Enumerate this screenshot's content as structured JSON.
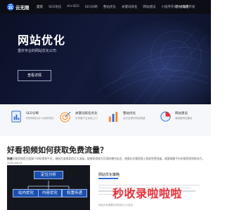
{
  "nav": {
    "logo_text": "云无限",
    "items": [
      "首页",
      "SEO优化",
      "AI+SEO",
      "SEO诊断",
      "整站优化",
      "关键词排名",
      "网站建设",
      "小程序开发",
      "APP开发"
    ],
    "phone": "热线电话"
  },
  "hero": {
    "title": "网站优化",
    "subtitle": "重庆专业的网站优化公司",
    "button": "查看详情",
    "slides_total": 3,
    "active_slide": 1
  },
  "features": [
    {
      "icon": "document-chart-icon",
      "title": "SEO诊断",
      "desc": "你的网站为什么没有排名？"
    },
    {
      "icon": "target-icon",
      "title": "关键词排名优化",
      "desc": "引导客户主动找上门"
    },
    {
      "icon": "bar-chart-icon",
      "title": "整站优化",
      "desc": "全方位提升网站权重"
    },
    {
      "icon": "pie-chart-icon",
      "title": "网站建设",
      "desc": "营销型网站建设"
    }
  ],
  "article": {
    "title": "好看视频如何获取免费流量？",
    "summary_lead": "快速",
    "summary": "好看视频是百度旗下的短视频平台，借助百度搜索的巨大流量，能够获得较为可观的曝光机会，想要在好看视频上获取免费流量，就要掌握平台的推荐规则和技巧。2025-08-21"
  },
  "mindmap": {
    "nodes": [
      "定位分析",
      "站内优化",
      "内容优化",
      "权重传递"
    ]
  },
  "strategy": {
    "title": "网站优化策略",
    "watermark": "秒收录啦啦啦",
    "footer": "网站优化需要持续的耐心与坚持"
  },
  "colors": {
    "nav_bg": "#0d0e15",
    "hero_bg": "#131a3a",
    "accent": "#1e6cff",
    "node_fill": "#1a4fb0",
    "watermark": "#e8323a"
  }
}
